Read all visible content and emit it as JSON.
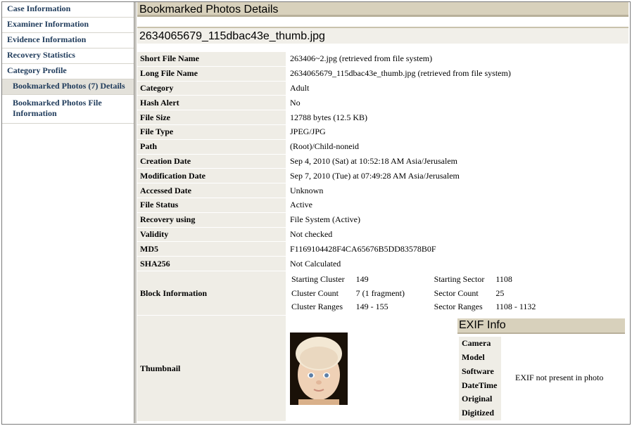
{
  "sidebar": {
    "items": [
      {
        "label": "Case Information"
      },
      {
        "label": "Examiner Information"
      },
      {
        "label": "Evidence Information"
      },
      {
        "label": "Recovery Statistics"
      },
      {
        "label": "Category Profile"
      },
      {
        "label": "Bookmarked Photos (7) Details"
      },
      {
        "label": "Bookmarked Photos File Information"
      }
    ]
  },
  "header": {
    "title": "Bookmarked Photos Details"
  },
  "file": {
    "name": "2634065679_115dbac43e_thumb.jpg"
  },
  "details": {
    "rows": [
      {
        "label": "Short File Name",
        "value": "263406~2.jpg (retrieved from file system)"
      },
      {
        "label": "Long File Name",
        "value": "2634065679_115dbac43e_thumb.jpg (retrieved from file system)"
      },
      {
        "label": "Category",
        "value": "Adult"
      },
      {
        "label": "Hash Alert",
        "value": "No"
      },
      {
        "label": "File Size",
        "value": "12788 bytes (12.5 KB)"
      },
      {
        "label": "File Type",
        "value": "JPEG/JPG"
      },
      {
        "label": "Path",
        "value": "(Root)/Child-noneid"
      },
      {
        "label": "Creation Date",
        "value": "Sep 4, 2010 (Sat) at 10:52:18 AM Asia/Jerusalem"
      },
      {
        "label": "Modification Date",
        "value": "Sep 7, 2010 (Tue) at 07:49:28 AM Asia/Jerusalem"
      },
      {
        "label": "Accessed Date",
        "value": "Unknown"
      },
      {
        "label": "File Status",
        "value": "Active"
      },
      {
        "label": "Recovery using",
        "value": "File System (Active)"
      },
      {
        "label": "Validity",
        "value": "Not checked"
      },
      {
        "label": "MD5",
        "value": "F1169104428F4CA65676B5DD83578B0F"
      },
      {
        "label": "SHA256",
        "value": "Not Calculated"
      }
    ],
    "block_label": "Block Information",
    "block": {
      "starting_cluster_label": "Starting Cluster",
      "starting_cluster": "149",
      "cluster_count_label": "Cluster Count",
      "cluster_count": "7 (1 fragment)",
      "cluster_ranges_label": "Cluster Ranges",
      "cluster_ranges": "149 - 155",
      "starting_sector_label": "Starting Sector",
      "starting_sector": "1108",
      "sector_count_label": "Sector Count",
      "sector_count": "25",
      "sector_ranges_label": "Sector Ranges",
      "sector_ranges": "1108 - 1132"
    },
    "thumbnail_label": "Thumbnail"
  },
  "exif": {
    "title": "EXIF Info",
    "labels": [
      "Camera",
      "Model",
      "Software",
      "DateTime",
      "Original",
      "Digitized"
    ],
    "message": "EXIF not present in photo"
  }
}
